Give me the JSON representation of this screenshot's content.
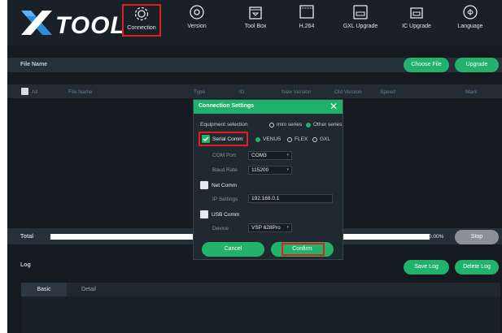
{
  "brand": {
    "name": "TOOL"
  },
  "nav": [
    {
      "label": "Connection",
      "icon": "gear-icon"
    },
    {
      "label": "Version",
      "icon": "at-sign-icon"
    },
    {
      "label": "Tool Box",
      "icon": "toolbox-icon"
    },
    {
      "label": "H.264",
      "icon": "chip-icon"
    },
    {
      "label": "GXL Upgrade",
      "icon": "device-icon"
    },
    {
      "label": "IC Upgrade",
      "icon": "card-icon"
    },
    {
      "label": "Language",
      "icon": "globe-icon"
    }
  ],
  "file_bar": {
    "label": "File Name",
    "choose_button": "Choose File",
    "upgrade_button": "Upgrade"
  },
  "table": {
    "all_label": "All",
    "columns": [
      "File Name",
      "Type",
      "ID",
      "New Version",
      "Old Version",
      "Speed",
      "Mark"
    ]
  },
  "total_bar": {
    "label": "Total",
    "percent_text": "0.00%",
    "stop_button": "Stop",
    "progress": 0
  },
  "log_bar": {
    "label": "Log",
    "save_button": "Save Log",
    "delete_button": "Delete Log"
  },
  "log_tabs": [
    "Basic",
    "Detail"
  ],
  "modal": {
    "title": "Connection Settings",
    "close_glyph": "✕",
    "equipment_label": "Equipment selection",
    "equipment_options": [
      "mini series",
      "Other series"
    ],
    "serial": {
      "label": "Serial Comm",
      "options": [
        "VENUS",
        "FLEX",
        "GXL"
      ],
      "com_port_label": "COM Port",
      "com_port_value": "COM3",
      "baud_label": "Baud Rate",
      "baud_value": "115200"
    },
    "net": {
      "label": "Net Comm",
      "ip_label": "IP Settings",
      "ip_value": "192.168.0.1"
    },
    "usb": {
      "label": "USB Comm",
      "device_label": "Device",
      "device_value": "VSP 628Pro"
    },
    "cancel_button": "Cancel",
    "confirm_button": "Confirm"
  },
  "colors": {
    "accent": "#22b26a",
    "highlight": "#e02020",
    "background": "#141a20"
  }
}
